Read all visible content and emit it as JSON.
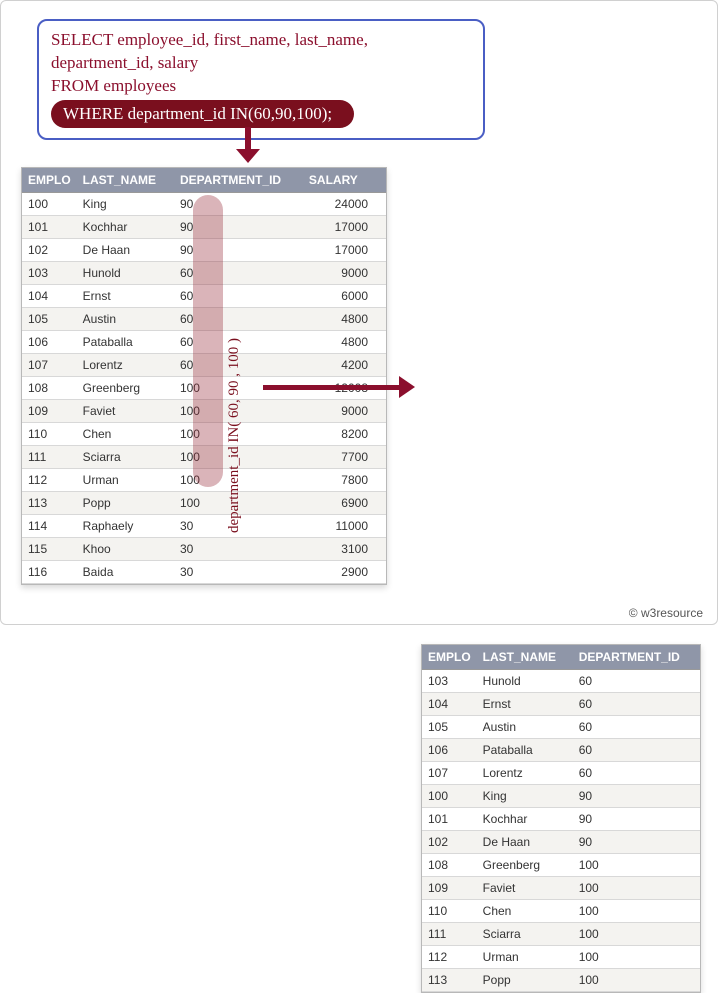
{
  "sql": {
    "line1": "SELECT employee_id, first_name, last_name,",
    "line2": "department_id, salary",
    "line3": "FROM employees",
    "where": "WHERE department_id IN(60,90,100);"
  },
  "highlight_label": "department_id IN( 60, 90 , 100 )",
  "left_table": {
    "headers": {
      "c1": "EMPLO",
      "c2": "LAST_NAME",
      "c3": "DEPARTMENT_ID",
      "c4": "SALARY"
    },
    "rows": [
      {
        "emp": "100",
        "last": "King",
        "dept": "90",
        "sal": "24000"
      },
      {
        "emp": "101",
        "last": "Kochhar",
        "dept": "90",
        "sal": "17000"
      },
      {
        "emp": "102",
        "last": "De Haan",
        "dept": "90",
        "sal": "17000"
      },
      {
        "emp": "103",
        "last": "Hunold",
        "dept": "60",
        "sal": "9000"
      },
      {
        "emp": "104",
        "last": "Ernst",
        "dept": "60",
        "sal": "6000"
      },
      {
        "emp": "105",
        "last": "Austin",
        "dept": "60",
        "sal": "4800"
      },
      {
        "emp": "106",
        "last": "Pataballa",
        "dept": "60",
        "sal": "4800"
      },
      {
        "emp": "107",
        "last": "Lorentz",
        "dept": "60",
        "sal": "4200"
      },
      {
        "emp": "108",
        "last": "Greenberg",
        "dept": "100",
        "sal": "12008"
      },
      {
        "emp": "109",
        "last": "Faviet",
        "dept": "100",
        "sal": "9000"
      },
      {
        "emp": "110",
        "last": "Chen",
        "dept": "100",
        "sal": "8200"
      },
      {
        "emp": "111",
        "last": "Sciarra",
        "dept": "100",
        "sal": "7700"
      },
      {
        "emp": "112",
        "last": "Urman",
        "dept": "100",
        "sal": "7800"
      },
      {
        "emp": "113",
        "last": "Popp",
        "dept": "100",
        "sal": "6900"
      },
      {
        "emp": "114",
        "last": "Raphaely",
        "dept": "30",
        "sal": "11000"
      },
      {
        "emp": "115",
        "last": "Khoo",
        "dept": "30",
        "sal": "3100"
      },
      {
        "emp": "116",
        "last": "Baida",
        "dept": "30",
        "sal": "2900"
      }
    ]
  },
  "right_table": {
    "headers": {
      "c1": "EMPLO",
      "c2": "LAST_NAME",
      "c3": "DEPARTMENT_ID"
    },
    "rows": [
      {
        "emp": "103",
        "last": "Hunold",
        "dept": "60"
      },
      {
        "emp": "104",
        "last": "Ernst",
        "dept": "60"
      },
      {
        "emp": "105",
        "last": "Austin",
        "dept": "60"
      },
      {
        "emp": "106",
        "last": "Pataballa",
        "dept": "60"
      },
      {
        "emp": "107",
        "last": "Lorentz",
        "dept": "60"
      },
      {
        "emp": "100",
        "last": "King",
        "dept": "90"
      },
      {
        "emp": "101",
        "last": "Kochhar",
        "dept": "90"
      },
      {
        "emp": "102",
        "last": "De Haan",
        "dept": "90"
      },
      {
        "emp": "108",
        "last": "Greenberg",
        "dept": "100"
      },
      {
        "emp": "109",
        "last": "Faviet",
        "dept": "100"
      },
      {
        "emp": "110",
        "last": "Chen",
        "dept": "100"
      },
      {
        "emp": "111",
        "last": "Sciarra",
        "dept": "100"
      },
      {
        "emp": "112",
        "last": "Urman",
        "dept": "100"
      },
      {
        "emp": "113",
        "last": "Popp",
        "dept": "100"
      }
    ]
  },
  "footer": "© w3resource"
}
